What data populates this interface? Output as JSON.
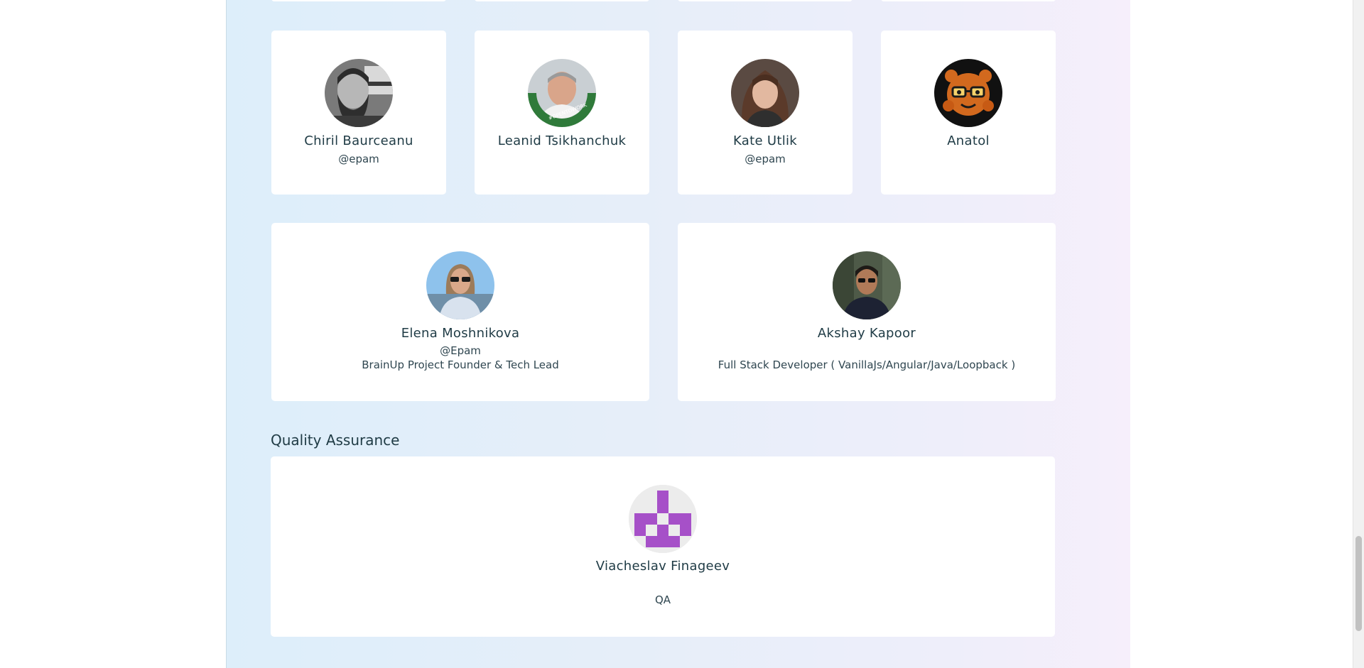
{
  "contributors": [
    {
      "name": "Chiril Baurceanu",
      "company": "@epam",
      "role": ""
    },
    {
      "name": "Leanid Tsikhanchuk",
      "company": "",
      "role": ""
    },
    {
      "name": "Kate Utlik",
      "company": "@epam",
      "role": ""
    },
    {
      "name": "Anatol",
      "company": "",
      "role": ""
    },
    {
      "name": "Elena Moshnikova",
      "company": "@Epam",
      "role": "BrainUp Project Founder & Tech Lead"
    },
    {
      "name": "Akshay Kapoor",
      "company": "",
      "role": "Full Stack Developer ( VanillaJs/Angular/Java/Loopback )"
    }
  ],
  "qa_section": {
    "title": "Quality Assurance",
    "members": [
      {
        "name": "Viacheslav Finageev",
        "role": "QA"
      }
    ]
  },
  "colors": {
    "text": "#1f3b45",
    "card": "#ffffff",
    "identicon": "#a650c8",
    "avatar_green_ring": "#2f7a3a"
  },
  "icons": {
    "avatar_0": "avatar-photo-icon",
    "avatar_1": "avatar-photo-icon",
    "avatar_2": "avatar-photo-icon",
    "avatar_3": "octocat-avatar-icon",
    "avatar_4": "avatar-photo-icon",
    "avatar_5": "avatar-photo-icon",
    "avatar_qa": "identicon-avatar-icon"
  }
}
